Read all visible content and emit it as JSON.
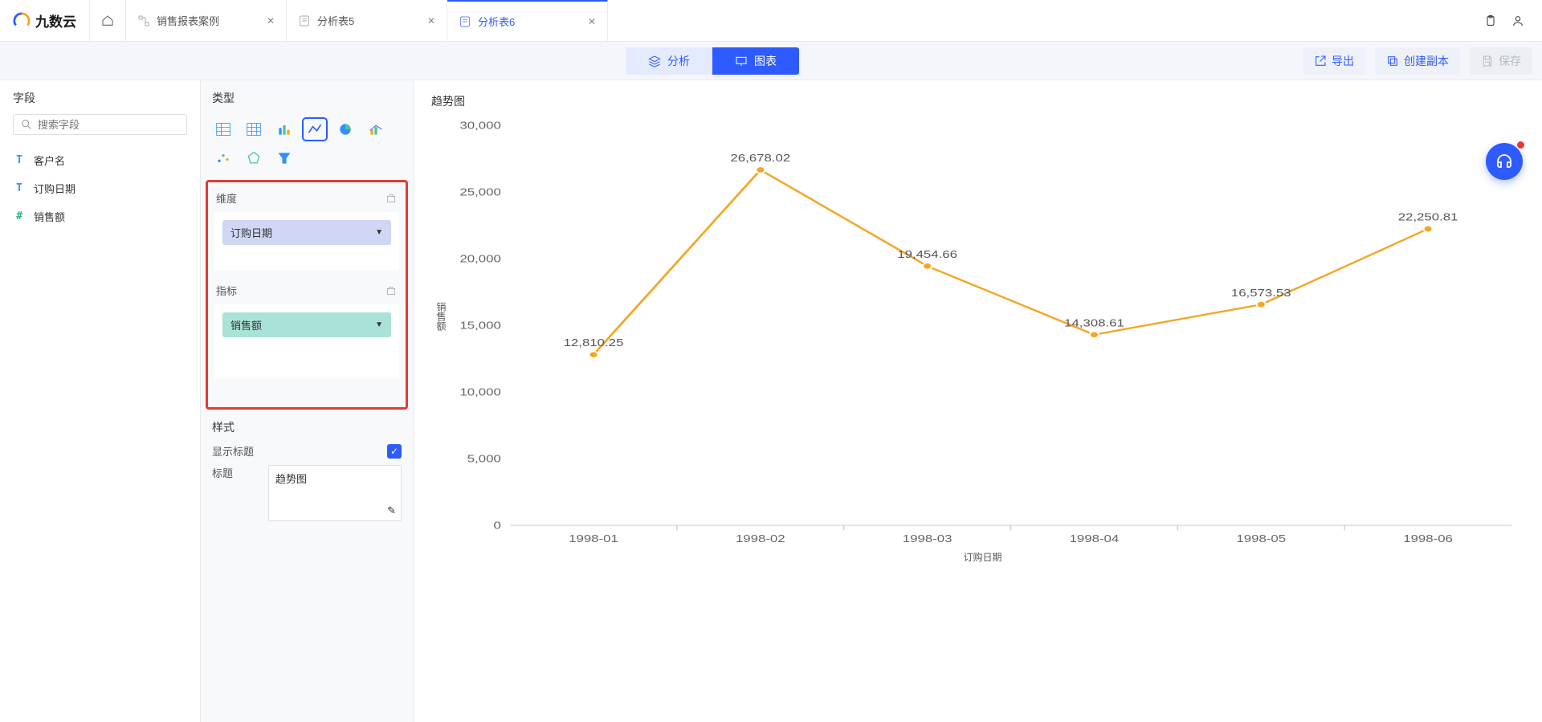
{
  "brand": "九数云",
  "tabs": [
    {
      "icon": "flow",
      "label": "销售报表案例"
    },
    {
      "icon": "sheet",
      "label": "分析表5"
    },
    {
      "icon": "sheet",
      "label": "分析表6",
      "active": true
    }
  ],
  "mode_switch": {
    "analyze": "分析",
    "chart": "图表"
  },
  "buttons": {
    "export": "导出",
    "copy": "创建副本",
    "save": "保存"
  },
  "fields_panel": {
    "title": "字段",
    "search_placeholder": "搜索字段",
    "items": [
      {
        "type": "T",
        "label": "客户名"
      },
      {
        "type": "T",
        "label": "订购日期"
      },
      {
        "type": "#",
        "label": "销售额"
      }
    ]
  },
  "config_panel": {
    "type_title": "类型",
    "dimension_title": "维度",
    "metric_title": "指标",
    "dimension_pill": "订购日期",
    "metric_pill": "销售额",
    "style_title": "样式",
    "show_title_label": "显示标题",
    "title_label": "标题",
    "title_value": "趋势图"
  },
  "chart_title": "趋势图",
  "chart_data": {
    "type": "line",
    "title": "趋势图",
    "xlabel": "订购日期",
    "ylabel": "销售额",
    "ylim": [
      0,
      30000
    ],
    "yticks": [
      0,
      5000,
      10000,
      15000,
      20000,
      25000,
      30000
    ],
    "ytick_labels": [
      "0",
      "5,000",
      "10,000",
      "15,000",
      "20,000",
      "25,000",
      "30,000"
    ],
    "categories": [
      "1998-01",
      "1998-02",
      "1998-03",
      "1998-04",
      "1998-05",
      "1998-06"
    ],
    "values": [
      12810.25,
      26678.02,
      19454.66,
      14308.61,
      16573.53,
      22250.81
    ],
    "value_labels": [
      "12,810.25",
      "26,678.02",
      "19,454.66",
      "14,308.61",
      "16,573.53",
      "22,250.81"
    ],
    "line_color": "#f5a623"
  }
}
